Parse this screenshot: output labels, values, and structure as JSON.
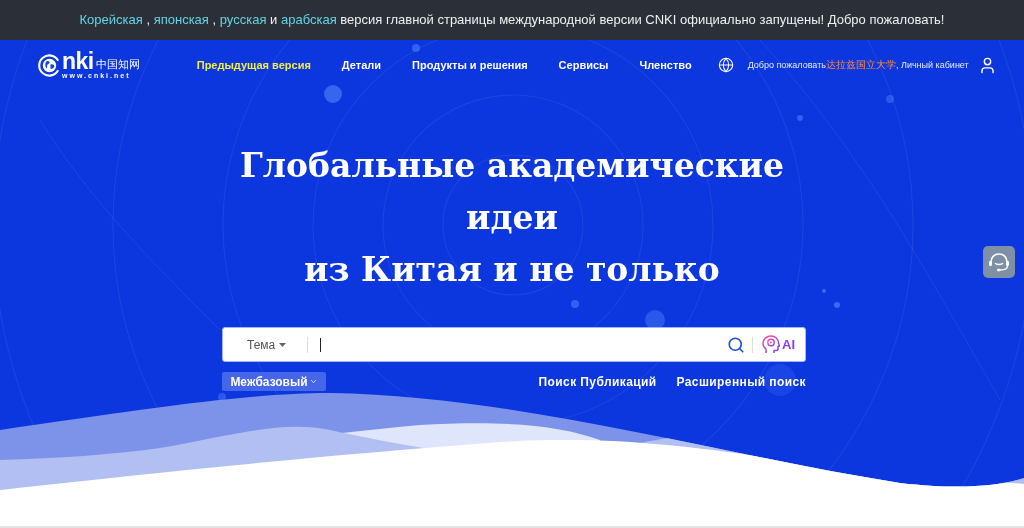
{
  "announcement": {
    "segments": [
      {
        "kind": "link",
        "text": "Корейская"
      },
      {
        "kind": "text",
        "text": ","
      },
      {
        "kind": "link",
        "text": "японская"
      },
      {
        "kind": "text",
        "text": ","
      },
      {
        "kind": "link",
        "text": "русская"
      },
      {
        "kind": "text",
        "text": "и"
      },
      {
        "kind": "link",
        "text": "арабская"
      },
      {
        "kind": "text",
        "text": "версия главной страницы международной версии CNKI официально запущены! Добро пожаловать!"
      }
    ]
  },
  "header": {
    "logo": {
      "mark": "nki",
      "chinese": "中国知网",
      "url": "www.cnki.net"
    },
    "nav": [
      {
        "label": "Предыдущая версия",
        "highlighted": true
      },
      {
        "label": "Детали",
        "highlighted": false
      },
      {
        "label": "Продукты и решения",
        "highlighted": false
      },
      {
        "label": "Сервисы",
        "highlighted": false
      },
      {
        "label": "Членство",
        "highlighted": false
      }
    ],
    "welcome": {
      "greeting": "Добро пожаловать",
      "user": "达拉兹国立大学",
      "separator": ",",
      "account": "Личный кабинет"
    }
  },
  "hero": {
    "title_lines": [
      "Глобальные академические",
      "идеи",
      "из Китая и не только"
    ]
  },
  "search": {
    "field_selector": "Тема",
    "ai_label": "AI",
    "database_selector": "Межбазовый",
    "links": [
      "Поиск Публикаций",
      "Расширенный поиск"
    ]
  }
}
